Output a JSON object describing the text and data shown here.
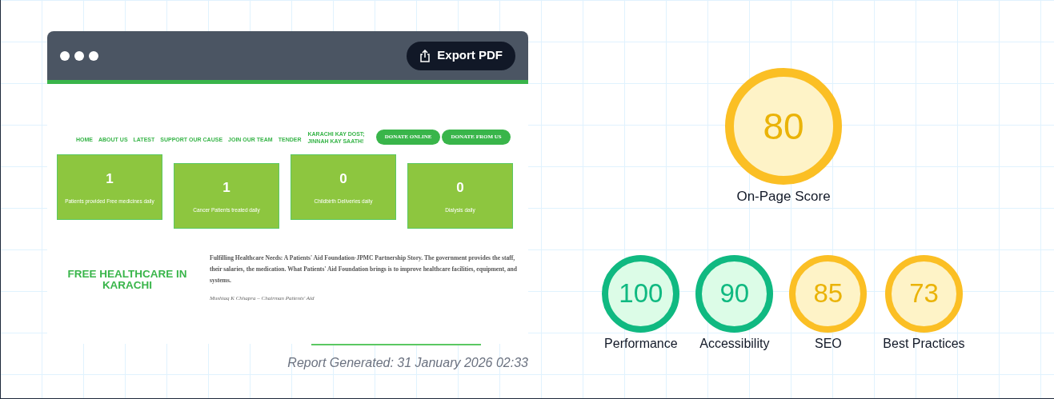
{
  "toolbar": {
    "button": "Export PDF"
  },
  "site": {
    "nav": [
      "HOME",
      "ABOUT US",
      "LATEST",
      "SUPPORT OUR CAUSE",
      "JOIN OUR TEAM",
      "TENDER"
    ],
    "tagline": [
      "KARACHI KAY DOST;",
      "JINNAH KAY SAATH!"
    ],
    "buttons": [
      "DONATE ONLINE",
      "DONATE FROM US"
    ],
    "stats": [
      {
        "value": "1",
        "label": "Patients provided Free medicines daily"
      },
      {
        "value": "1",
        "label": "Cancer Patients treated daily"
      },
      {
        "value": "0",
        "label": "Childbirth Deliveries daily"
      },
      {
        "value": "0",
        "label": "Dialysis daily"
      }
    ],
    "heading": "FREE HEALTHCARE IN KARACHI",
    "paragraph": "Fulfilling Healthcare Needs: A Patients' Aid Foundation-JPMC Partnership Story. The government provides the staff, their salaries, the medication. What Patients' Aid Foundation brings is to improve healthcare facilities, equipment, and systems.",
    "quote": "Mushtaq K Chhapra – Chairman Patients' Aid"
  },
  "report_generated": "Report Generated: 31 January 2026 02:33",
  "main_score": {
    "value": "80",
    "label": "On-Page Score",
    "color": "#fbbf24"
  },
  "scores": [
    {
      "value": "100",
      "label": "Performance",
      "color": "#10b981"
    },
    {
      "value": "90",
      "label": "Accessibility",
      "color": "#10b981"
    },
    {
      "value": "85",
      "label": "SEO",
      "color": "#fbbf24"
    },
    {
      "value": "73",
      "label": "Best Practices",
      "color": "#fbbf24"
    }
  ]
}
